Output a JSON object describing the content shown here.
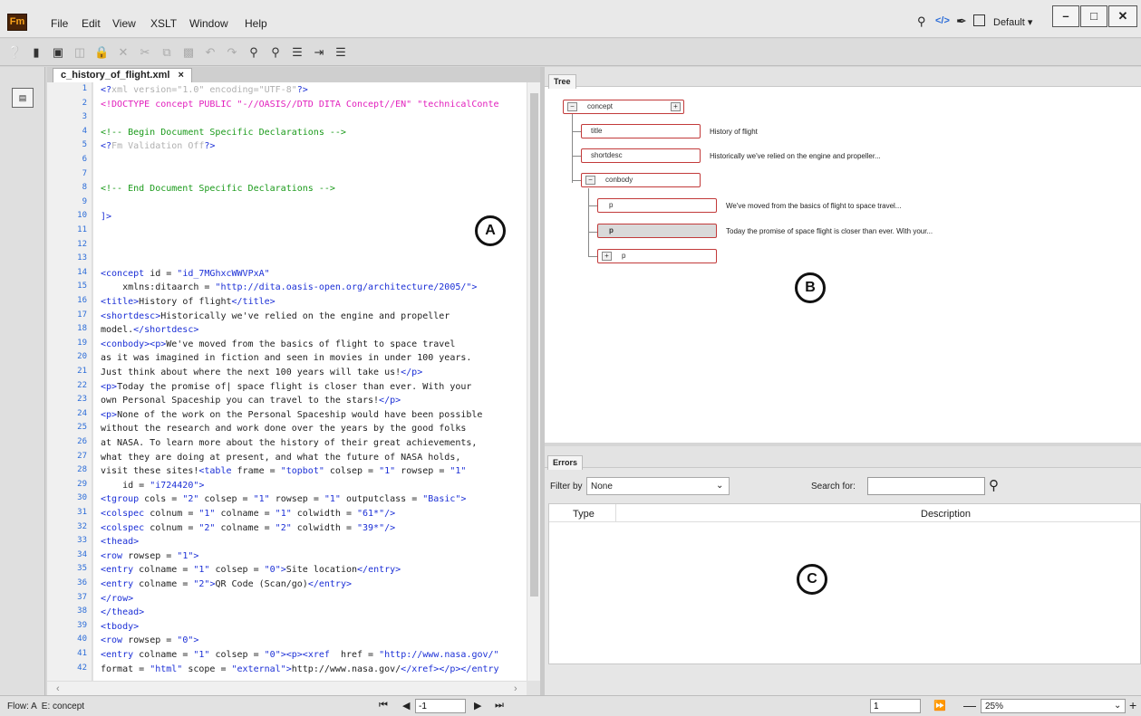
{
  "app": {
    "logo": "Fm"
  },
  "menu": [
    "File",
    "Edit",
    "View",
    "XSLT",
    "Window",
    "Help"
  ],
  "workspace": {
    "label": "Default",
    "dropdown_arrow": "▾"
  },
  "window_buttons": {
    "minimize": "–",
    "maximize": "□",
    "close": "✕"
  },
  "toolbar_icons": [
    "help-icon",
    "new-doc-icon",
    "open-icon",
    "save-icon",
    "lock-icon",
    "close-doc-icon",
    "cut-icon",
    "copy-icon",
    "paste-icon",
    "undo-icon",
    "redo-icon",
    "find-icon",
    "find-next-icon",
    "indent-icon",
    "outdent-icon",
    "list-icon"
  ],
  "editor": {
    "tab_label": "c_history_of_flight.xml",
    "tab_close": "×",
    "lines": [
      {
        "n": "1",
        "segs": [
          [
            "t",
            "<?"
          ],
          [
            "pi",
            "xml version=\"1.0\" encoding=\"UTF-8\""
          ],
          [
            "t",
            "?>"
          ]
        ]
      },
      {
        "n": "2",
        "segs": [
          [
            "dt",
            "<!DOCTYPE concept PUBLIC \"-//OASIS//DTD DITA Concept//EN\" \"technicalConte"
          ]
        ]
      },
      {
        "n": "3",
        "segs": []
      },
      {
        "n": "4",
        "segs": [
          [
            "cm",
            "<!-- Begin Document Specific Declarations -->"
          ]
        ]
      },
      {
        "n": "5",
        "segs": [
          [
            "t",
            "<?"
          ],
          [
            "pi",
            "Fm Validation Off"
          ],
          [
            "t",
            "?>"
          ]
        ]
      },
      {
        "n": "6",
        "segs": []
      },
      {
        "n": "7",
        "segs": []
      },
      {
        "n": "8",
        "segs": [
          [
            "cm",
            "<!-- End Document Specific Declarations -->"
          ]
        ]
      },
      {
        "n": "9",
        "segs": []
      },
      {
        "n": "10",
        "segs": [
          [
            "t",
            "]>"
          ]
        ]
      },
      {
        "n": "11",
        "segs": []
      },
      {
        "n": "12",
        "segs": []
      },
      {
        "n": "13",
        "segs": []
      },
      {
        "n": "14",
        "segs": [
          [
            "t",
            "<concept "
          ],
          [
            "tx",
            "id = "
          ],
          [
            "av",
            "\"id_7MGhxcWWVPxA\""
          ]
        ]
      },
      {
        "n": "15",
        "segs": [
          [
            "tx",
            "    xmlns:ditaarch = "
          ],
          [
            "av",
            "\"http://dita.oasis-open.org/architecture/2005/\""
          ],
          [
            "t",
            ">"
          ]
        ]
      },
      {
        "n": "16",
        "segs": [
          [
            "t",
            "<title>"
          ],
          [
            "tx",
            "History of flight"
          ],
          [
            "t",
            "</title>"
          ]
        ]
      },
      {
        "n": "17",
        "segs": [
          [
            "t",
            "<shortdesc>"
          ],
          [
            "tx",
            "Historically we've relied on the engine and propeller"
          ]
        ]
      },
      {
        "n": "18",
        "segs": [
          [
            "tx",
            "model."
          ],
          [
            "t",
            "</shortdesc>"
          ]
        ]
      },
      {
        "n": "19",
        "segs": [
          [
            "t",
            "<conbody><p>"
          ],
          [
            "tx",
            "We've moved from the basics of flight to space travel"
          ]
        ]
      },
      {
        "n": "20",
        "segs": [
          [
            "tx",
            "as it was imagined in fiction and seen in movies in under 100 years."
          ]
        ]
      },
      {
        "n": "21",
        "segs": [
          [
            "tx",
            "Just think about where the next 100 years will take us!"
          ],
          [
            "t",
            "</p>"
          ]
        ]
      },
      {
        "n": "22",
        "segs": [
          [
            "t",
            "<p>"
          ],
          [
            "tx",
            "Today the promise of| space flight is closer than ever. With your"
          ]
        ]
      },
      {
        "n": "23",
        "segs": [
          [
            "tx",
            "own Personal Spaceship you can travel to the stars!"
          ],
          [
            "t",
            "</p>"
          ]
        ]
      },
      {
        "n": "24",
        "segs": [
          [
            "t",
            "<p>"
          ],
          [
            "tx",
            "None of the work on the Personal Spaceship would have been possible"
          ]
        ]
      },
      {
        "n": "25",
        "segs": [
          [
            "tx",
            "without the research and work done over the years by the good folks"
          ]
        ]
      },
      {
        "n": "26",
        "segs": [
          [
            "tx",
            "at NASA. To learn more about the history of their great achievements,"
          ]
        ]
      },
      {
        "n": "27",
        "segs": [
          [
            "tx",
            "what they are doing at present, and what the future of NASA holds,"
          ]
        ]
      },
      {
        "n": "28",
        "segs": [
          [
            "tx",
            "visit these sites!"
          ],
          [
            "t",
            "<table "
          ],
          [
            "tx",
            "frame = "
          ],
          [
            "av",
            "\"topbot\""
          ],
          [
            "tx",
            " colsep = "
          ],
          [
            "av",
            "\"1\""
          ],
          [
            "tx",
            " rowsep = "
          ],
          [
            "av",
            "\"1\""
          ]
        ]
      },
      {
        "n": "29",
        "segs": [
          [
            "tx",
            "    id = "
          ],
          [
            "av",
            "\"i724420\""
          ],
          [
            "t",
            ">"
          ]
        ]
      },
      {
        "n": "30",
        "segs": [
          [
            "t",
            "<tgroup "
          ],
          [
            "tx",
            "cols = "
          ],
          [
            "av",
            "\"2\""
          ],
          [
            "tx",
            " colsep = "
          ],
          [
            "av",
            "\"1\""
          ],
          [
            "tx",
            " rowsep = "
          ],
          [
            "av",
            "\"1\""
          ],
          [
            "tx",
            " outputclass = "
          ],
          [
            "av",
            "\"Basic\""
          ],
          [
            "t",
            ">"
          ]
        ]
      },
      {
        "n": "31",
        "segs": [
          [
            "t",
            "<colspec "
          ],
          [
            "tx",
            "colnum = "
          ],
          [
            "av",
            "\"1\""
          ],
          [
            "tx",
            " colname = "
          ],
          [
            "av",
            "\"1\""
          ],
          [
            "tx",
            " colwidth = "
          ],
          [
            "av",
            "\"61*\""
          ],
          [
            "t",
            "/>"
          ]
        ]
      },
      {
        "n": "32",
        "segs": [
          [
            "t",
            "<colspec "
          ],
          [
            "tx",
            "colnum = "
          ],
          [
            "av",
            "\"2\""
          ],
          [
            "tx",
            " colname = "
          ],
          [
            "av",
            "\"2\""
          ],
          [
            "tx",
            " colwidth = "
          ],
          [
            "av",
            "\"39*\""
          ],
          [
            "t",
            "/>"
          ]
        ]
      },
      {
        "n": "33",
        "segs": [
          [
            "t",
            "<thead>"
          ]
        ]
      },
      {
        "n": "34",
        "segs": [
          [
            "t",
            "<row "
          ],
          [
            "tx",
            "rowsep = "
          ],
          [
            "av",
            "\"1\""
          ],
          [
            "t",
            ">"
          ]
        ]
      },
      {
        "n": "35",
        "segs": [
          [
            "t",
            "<entry "
          ],
          [
            "tx",
            "colname = "
          ],
          [
            "av",
            "\"1\""
          ],
          [
            "tx",
            " colsep = "
          ],
          [
            "av",
            "\"0\""
          ],
          [
            "t",
            ">"
          ],
          [
            "tx",
            "Site location"
          ],
          [
            "t",
            "</entry>"
          ]
        ]
      },
      {
        "n": "36",
        "segs": [
          [
            "t",
            "<entry "
          ],
          [
            "tx",
            "colname = "
          ],
          [
            "av",
            "\"2\""
          ],
          [
            "t",
            ">"
          ],
          [
            "tx",
            "QR Code (Scan/go)"
          ],
          [
            "t",
            "</entry>"
          ]
        ]
      },
      {
        "n": "37",
        "segs": [
          [
            "t",
            "</row>"
          ]
        ]
      },
      {
        "n": "38",
        "segs": [
          [
            "t",
            "</thead>"
          ]
        ]
      },
      {
        "n": "39",
        "segs": [
          [
            "t",
            "<tbody>"
          ]
        ]
      },
      {
        "n": "40",
        "segs": [
          [
            "t",
            "<row "
          ],
          [
            "tx",
            "rowsep = "
          ],
          [
            "av",
            "\"0\""
          ],
          [
            "t",
            ">"
          ]
        ]
      },
      {
        "n": "41",
        "segs": [
          [
            "t",
            "<entry "
          ],
          [
            "tx",
            "colname = "
          ],
          [
            "av",
            "\"1\""
          ],
          [
            "tx",
            " colsep = "
          ],
          [
            "av",
            "\"0\""
          ],
          [
            "t",
            "><p><xref "
          ],
          [
            "tx",
            " href = "
          ],
          [
            "av",
            "\"http://www.nasa.gov/\""
          ]
        ]
      },
      {
        "n": "42",
        "segs": [
          [
            "tx",
            "format = "
          ],
          [
            "av",
            "\"html\""
          ],
          [
            "tx",
            " scope = "
          ],
          [
            "av",
            "\"external\""
          ],
          [
            "t",
            ">"
          ],
          [
            "tx",
            "http://www.nasa.gov/"
          ],
          [
            "t",
            "</xref></p></entry"
          ]
        ]
      }
    ]
  },
  "callouts": {
    "a": "A",
    "b": "B",
    "c": "C"
  },
  "tree": {
    "tab_label": "Tree",
    "root": {
      "tag": "concept",
      "toggle": "−",
      "plus": "+"
    },
    "children": [
      {
        "tag": "title",
        "text": "History of flight"
      },
      {
        "tag": "shortdesc",
        "text": "Historically we've relied on the engine and propeller..."
      },
      {
        "tag": "conbody",
        "toggle": "−"
      }
    ],
    "conbody_children": [
      {
        "tag": "p",
        "text": "We've moved from the basics of flight to space travel..."
      },
      {
        "tag": "p",
        "text": "Today the promise of space flight is closer than ever. With your..."
      },
      {
        "tag": "p",
        "toggle": "+"
      }
    ]
  },
  "errors": {
    "tab_label": "Errors",
    "filter_label": "Filter by",
    "filter_value": "None",
    "search_label": "Search for:",
    "search_value": "",
    "columns": [
      "Type",
      "Description"
    ]
  },
  "status": {
    "flow": "Flow: A  E: concept",
    "page_field": "-1",
    "page_number": "1",
    "zoom": "25%"
  }
}
